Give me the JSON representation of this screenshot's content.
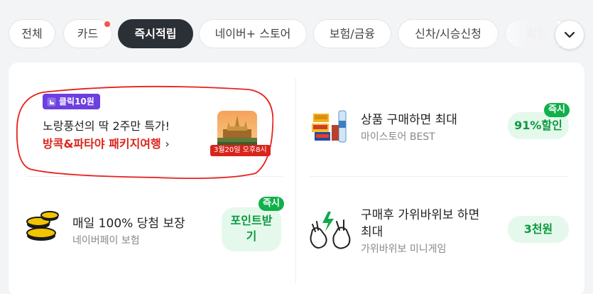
{
  "tabs": [
    {
      "label": "전체",
      "active": false,
      "dot": false
    },
    {
      "label": "카드",
      "active": false,
      "dot": true
    },
    {
      "label": "즉시적립",
      "active": true,
      "dot": false
    },
    {
      "label": "네이버+ 스토어",
      "active": false,
      "dot": false
    },
    {
      "label": "보험/금융",
      "active": false,
      "dot": false
    },
    {
      "label": "신차/시승신청",
      "active": false,
      "dot": false
    },
    {
      "label": "회원",
      "active": false,
      "dot": false
    }
  ],
  "ad": {
    "badge": "클릭10원",
    "line1": "노랑풍선의 딱 2주만 특가!",
    "line2": "방콕&파타야 패키지여행",
    "chevron": "›",
    "date_tag": "3월20일 오후8시"
  },
  "items": [
    {
      "title": "상품 구매하면 최대",
      "subtitle": "마이스토어 BEST",
      "reward": "91%할인",
      "instant": "즉시"
    },
    {
      "title": "매일 100% 당첨 보장",
      "subtitle": "네이버페이 보험",
      "reward_line1": "포인트받",
      "reward_line2": "기",
      "instant": "즉시"
    },
    {
      "title_line1": "구매후 가위바위보 하면",
      "title_line2": "최대",
      "subtitle": "가위바위보 미니게임",
      "reward": "3천원"
    }
  ],
  "colors": {
    "accent_green": "#0a9a3f",
    "reward_bg": "#e5f8ec",
    "badge_purple": "#6b3fe0",
    "ad_red": "#d9241b",
    "active_tab": "#2b2f36"
  }
}
